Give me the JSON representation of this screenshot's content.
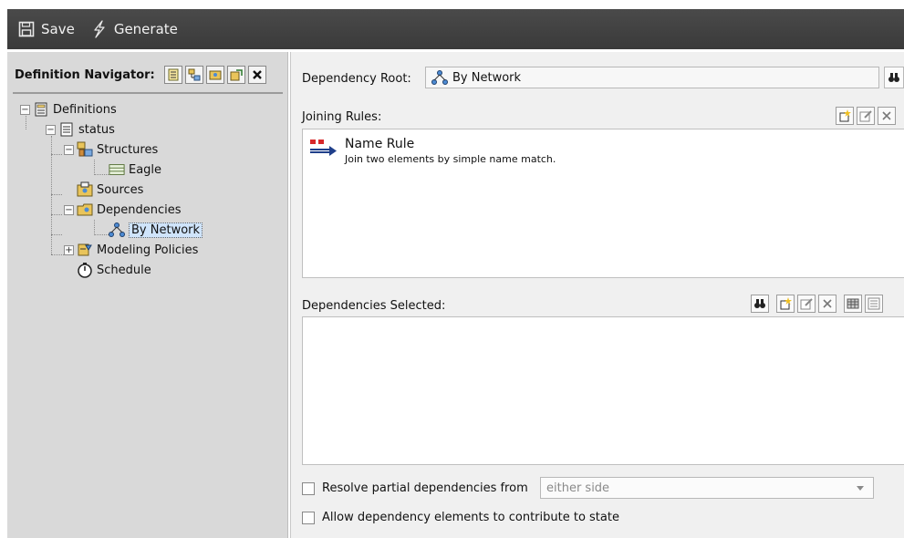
{
  "toolbar": {
    "save_label": "Save",
    "generate_label": "Generate"
  },
  "navigator": {
    "title": "Definition Navigator:",
    "tree": {
      "definitions": "Definitions",
      "status": "status",
      "structures": "Structures",
      "eagle": "Eagle",
      "sources": "Sources",
      "dependencies": "Dependencies",
      "by_network": "By Network",
      "modeling_policies": "Modeling Policies",
      "schedule": "Schedule"
    }
  },
  "main": {
    "dependency_root_label": "Dependency Root:",
    "dependency_root_value": "By Network",
    "joining_rules_label": "Joining Rules:",
    "joining_rules": [
      {
        "name": "Name Rule",
        "description": "Join two elements by simple name match."
      }
    ],
    "dependencies_selected_label": "Dependencies Selected:",
    "resolve_label": "Resolve partial dependencies from",
    "resolve_option": "either side",
    "allow_label": "Allow dependency elements to contribute to state"
  },
  "colors": {
    "toolbar_bg": "#3f3f3f",
    "navigator_bg": "#d9d9d9",
    "panel_bg": "#f0f0f0",
    "selection_bg": "#cfe4fb"
  },
  "icons": [
    "save-icon",
    "generate-icon",
    "binoculars-icon",
    "new-icon",
    "edit-icon",
    "delete-icon"
  ]
}
